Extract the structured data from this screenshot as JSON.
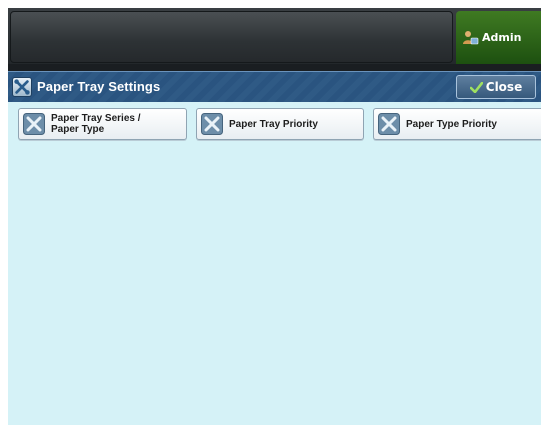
{
  "header": {
    "user_label": "Admin",
    "user_icon": "user-key-icon"
  },
  "titlebar": {
    "title": "Paper Tray Settings",
    "icon": "tools-icon",
    "close_label": "Close",
    "close_icon": "check-icon"
  },
  "options": [
    {
      "label": "Paper Tray Series /\nPaper Type",
      "icon": "tools-icon"
    },
    {
      "label": "Paper Tray Priority",
      "icon": "tools-icon"
    },
    {
      "label": "Paper Type Priority",
      "icon": "tools-icon"
    }
  ],
  "colors": {
    "title_bar": "#2f5a85",
    "content_bg": "#d5f2f7",
    "admin_tab": "#2f6a19"
  }
}
